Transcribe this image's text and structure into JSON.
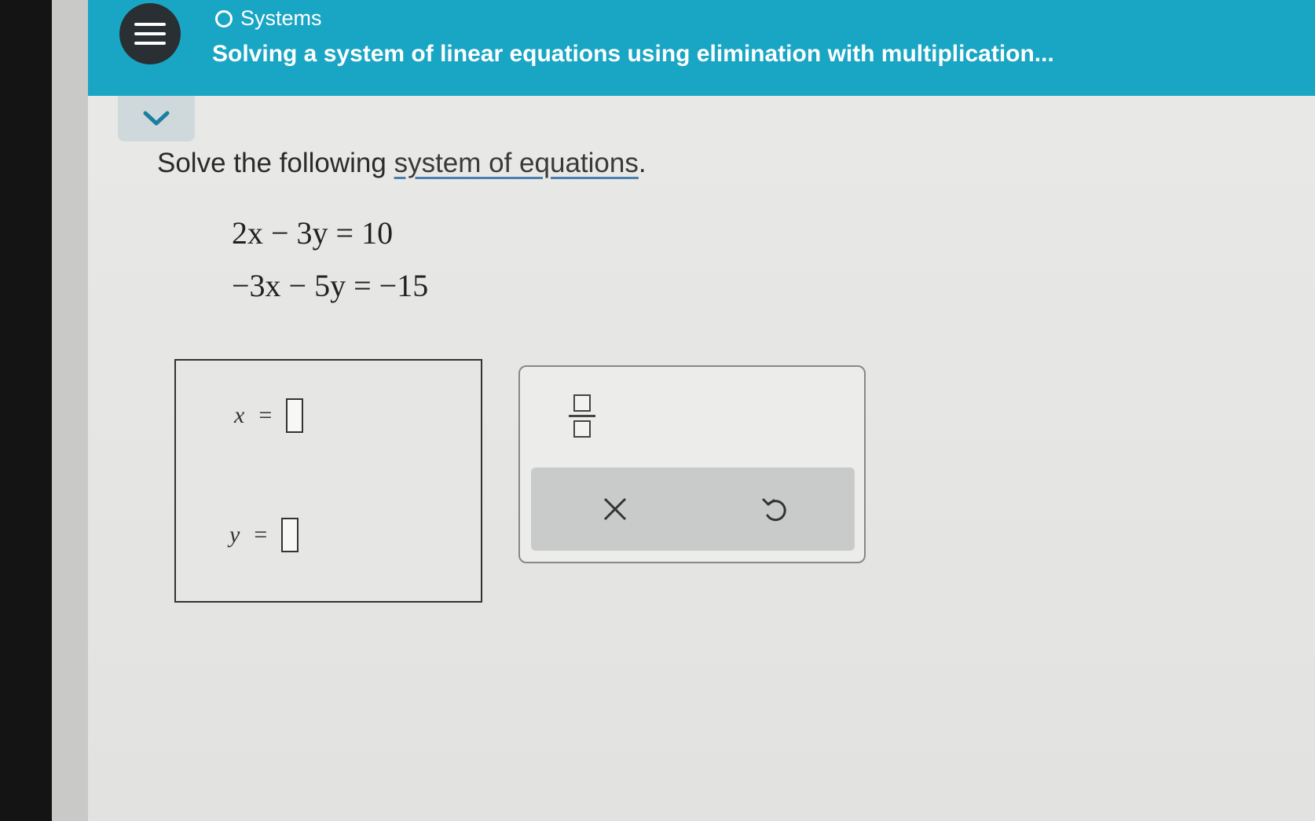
{
  "header": {
    "topic_label": "Systems",
    "lesson_title": "Solving a system of linear equations using elimination with multiplication..."
  },
  "icons": {
    "menu": "hamburger-menu-icon",
    "topic": "circle-outline-icon",
    "collapse": "chevron-down-icon",
    "fraction": "fraction-icon",
    "clear": "x-icon",
    "undo": "undo-icon"
  },
  "question": {
    "prompt_prefix": "Solve the following ",
    "prompt_link": "system of equations",
    "prompt_suffix": ".",
    "equation_1": "2x − 3y = 10",
    "equation_2": "−3x − 5y = −15"
  },
  "answer": {
    "x_label": "x",
    "y_label": "y",
    "equals": "=",
    "x_value": "",
    "y_value": ""
  },
  "colors": {
    "header": "#19a6c4",
    "background": "#e3e3e1",
    "link_underline": "#4a7fb0"
  }
}
